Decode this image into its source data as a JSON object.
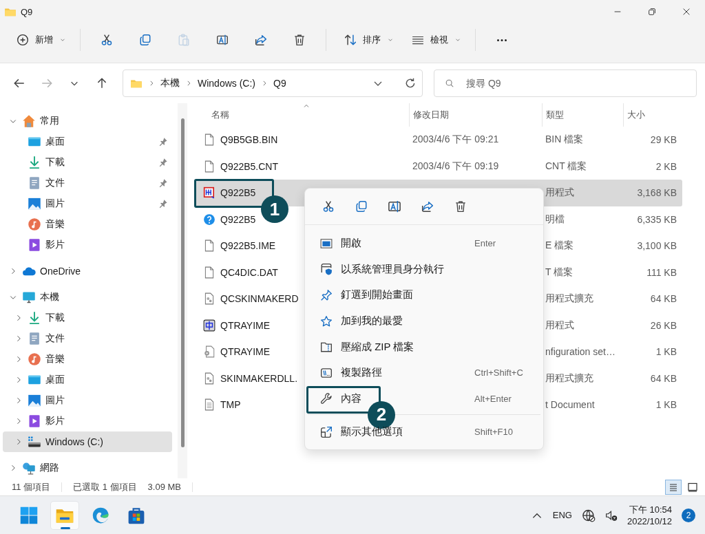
{
  "window": {
    "title": "Q9"
  },
  "toolbar": {
    "items": [
      {
        "kind": "new",
        "label": "新增",
        "disabled": false
      },
      {
        "kind": "cut",
        "disabled": false
      },
      {
        "kind": "copy",
        "disabled": false
      },
      {
        "kind": "paste",
        "disabled": true
      },
      {
        "kind": "rename",
        "disabled": false
      },
      {
        "kind": "share",
        "disabled": false
      },
      {
        "kind": "delete",
        "disabled": false
      },
      {
        "kind": "sort",
        "label": "排序",
        "disabled": false
      },
      {
        "kind": "view",
        "label": "檢視",
        "disabled": false
      },
      {
        "kind": "more",
        "disabled": false
      }
    ]
  },
  "navigation": [
    {
      "kind": "back",
      "disabled": false
    },
    {
      "kind": "forward",
      "disabled": true
    },
    {
      "kind": "recent",
      "disabled": false
    },
    {
      "kind": "up",
      "disabled": false
    }
  ],
  "address": {
    "crumbs": [
      "本機",
      "Windows (C:)",
      "Q9"
    ]
  },
  "search": {
    "placeholder": "搜尋 Q9"
  },
  "sidebar": {
    "items": [
      {
        "label": "常用",
        "kind": "home",
        "expanded": true,
        "selected": false,
        "children": [
          {
            "label": "桌面",
            "kind": "desktop",
            "pinned": true,
            "selected": false
          },
          {
            "label": "下載",
            "kind": "download",
            "pinned": true,
            "selected": false
          },
          {
            "label": "文件",
            "kind": "documents",
            "pinned": true,
            "selected": false
          },
          {
            "label": "圖片",
            "kind": "pictures",
            "pinned": true,
            "selected": false
          },
          {
            "label": "音樂",
            "kind": "music",
            "pinned": false,
            "selected": false
          },
          {
            "label": "影片",
            "kind": "videos",
            "pinned": false,
            "selected": false
          }
        ]
      },
      {
        "label": "OneDrive",
        "kind": "cloud",
        "expanded": false,
        "selected": false
      },
      {
        "label": "本機",
        "kind": "pc",
        "expanded": true,
        "selected": false,
        "children": [
          {
            "label": "下載",
            "kind": "download",
            "expanded": false,
            "selected": false
          },
          {
            "label": "文件",
            "kind": "documents",
            "expanded": false,
            "selected": false
          },
          {
            "label": "音樂",
            "kind": "music",
            "expanded": false,
            "selected": false
          },
          {
            "label": "桌面",
            "kind": "desktop",
            "expanded": false,
            "selected": false
          },
          {
            "label": "圖片",
            "kind": "pictures",
            "expanded": false,
            "selected": false
          },
          {
            "label": "影片",
            "kind": "videos",
            "expanded": false,
            "selected": false
          },
          {
            "label": "Windows (C:)",
            "kind": "drive",
            "expanded": false,
            "selected": true
          }
        ]
      },
      {
        "label": "網路",
        "kind": "network",
        "expanded": false,
        "selected": false
      }
    ]
  },
  "files": {
    "columns": [
      {
        "label": "名稱",
        "sorted": true
      },
      {
        "label": "修改日期",
        "sorted": false
      },
      {
        "label": "類型",
        "sorted": false
      },
      {
        "label": "大小",
        "sorted": false
      }
    ],
    "rows": [
      {
        "name": "Q9B5GB.BIN",
        "date": "2003/4/6 下午 09:21",
        "type": "BIN 檔案",
        "size": "29 KB",
        "kind": "blank",
        "selected": false
      },
      {
        "name": "Q922B5.CNT",
        "date": "2003/4/6 下午 09:19",
        "type": "CNT 檔案",
        "size": "2 KB",
        "kind": "blank",
        "selected": false
      },
      {
        "name": "Q922B5",
        "type": "用程式",
        "size": "3,168 KB",
        "kind": "ime-app",
        "selected": true,
        "callout": "1"
      },
      {
        "name": "Q922B5",
        "type": "明檔",
        "size": "6,335 KB",
        "kind": "help",
        "selected": false
      },
      {
        "name": "Q922B5.IME",
        "type": "E 檔案",
        "size": "3,100 KB",
        "kind": "blank",
        "selected": false
      },
      {
        "name": "QC4DIC.DAT",
        "type": "T 檔案",
        "size": "111 KB",
        "kind": "blank",
        "selected": false
      },
      {
        "name": "QCSKINMAKERD",
        "type": "用程式擴充",
        "size": "64 KB",
        "kind": "dll",
        "selected": false
      },
      {
        "name": "QTRAYIME",
        "type": "用程式",
        "size": "26 KB",
        "kind": "zh-app",
        "selected": false
      },
      {
        "name": "QTRAYIME",
        "type": "nfiguration set…",
        "size": "1 KB",
        "kind": "config",
        "selected": false
      },
      {
        "name": "SKINMAKERDLL.",
        "type": "用程式擴充",
        "size": "64 KB",
        "kind": "dll",
        "selected": false
      },
      {
        "name": "TMP",
        "type": "t Document",
        "size": "1 KB",
        "kind": "text",
        "selected": false
      }
    ]
  },
  "context_menu": {
    "items": [
      {
        "kind": "open",
        "label": "開啟",
        "shortcut": "Enter"
      },
      {
        "kind": "admin",
        "label": "以系統管理員身分執行"
      },
      {
        "kind": "pin",
        "label": "釘選到開始畫面"
      },
      {
        "kind": "star",
        "label": "加到我的最愛"
      },
      {
        "kind": "zip",
        "label": "壓縮成 ZIP 檔案"
      },
      {
        "kind": "copy-path",
        "label": "複製路徑",
        "shortcut": "Ctrl+Shift+C"
      },
      {
        "kind": "properties",
        "label": "內容",
        "shortcut": "Alt+Enter",
        "callout": "2"
      },
      {
        "kind": "more-options",
        "label": "顯示其他選項",
        "shortcut": "Shift+F10"
      }
    ]
  },
  "status_bar": {
    "item_count": "11 個項目",
    "selection": "已選取 1 個項目",
    "selection_size": "3.09 MB",
    "view_buttons": [
      {
        "kind": "details",
        "selected": true
      },
      {
        "kind": "tiles",
        "selected": false
      }
    ]
  },
  "taskbar": {
    "apps": [
      {
        "kind": "start",
        "active": false
      },
      {
        "kind": "explorer",
        "active": true
      },
      {
        "kind": "edge",
        "active": false
      },
      {
        "kind": "store",
        "active": false
      }
    ],
    "language": "ENG",
    "time": "下午 10:54",
    "date": "2022/10/12",
    "notification_count": "2"
  }
}
